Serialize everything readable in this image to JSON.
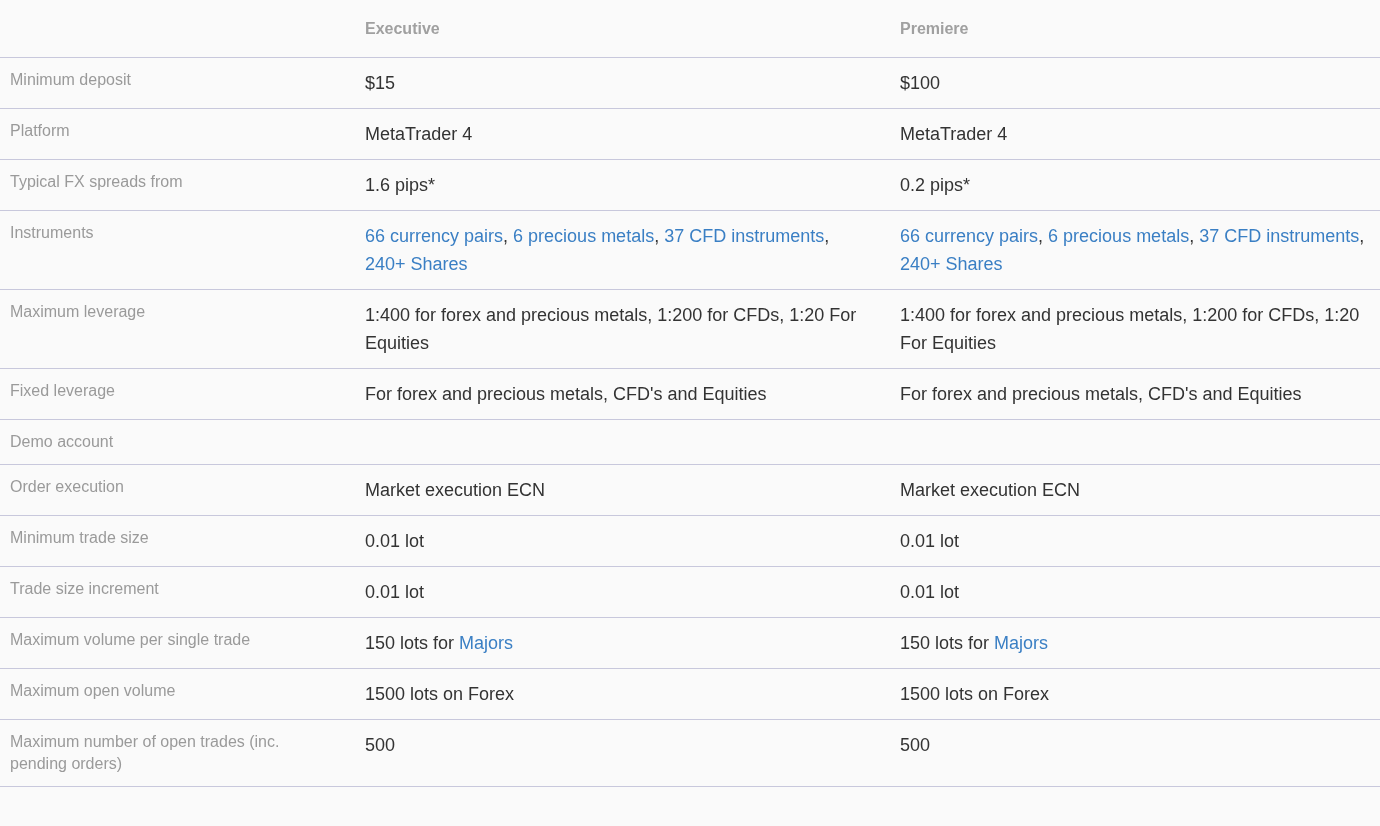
{
  "table": {
    "columns": [
      "Executive",
      "Premiere"
    ],
    "rows": [
      {
        "label": "Minimum deposit",
        "values": [
          [
            {
              "kind": "text",
              "text": "$15"
            }
          ],
          [
            {
              "kind": "text",
              "text": "$100"
            }
          ]
        ]
      },
      {
        "label": "Platform",
        "values": [
          [
            {
              "kind": "text",
              "text": "MetaTrader 4"
            }
          ],
          [
            {
              "kind": "text",
              "text": "MetaTrader 4"
            }
          ]
        ]
      },
      {
        "label": "Typical FX spreads from",
        "values": [
          [
            {
              "kind": "text",
              "text": "1.6 pips*"
            }
          ],
          [
            {
              "kind": "text",
              "text": "0.2 pips*"
            }
          ]
        ]
      },
      {
        "label": "Instruments",
        "values": [
          [
            {
              "kind": "link",
              "text": "66 currency pairs"
            },
            {
              "kind": "text",
              "text": ", "
            },
            {
              "kind": "link",
              "text": "6 precious metals"
            },
            {
              "kind": "text",
              "text": ", "
            },
            {
              "kind": "link",
              "text": "37 CFD instruments"
            },
            {
              "kind": "text",
              "text": ", "
            },
            {
              "kind": "link",
              "text": "240+ Shares"
            }
          ],
          [
            {
              "kind": "link",
              "text": "66 currency pairs"
            },
            {
              "kind": "text",
              "text": ", "
            },
            {
              "kind": "link",
              "text": "6 precious metals"
            },
            {
              "kind": "text",
              "text": ", "
            },
            {
              "kind": "link",
              "text": "37 CFD instruments"
            },
            {
              "kind": "text",
              "text": ", "
            },
            {
              "kind": "link",
              "text": "240+ Shares"
            }
          ]
        ]
      },
      {
        "label": "Maximum leverage",
        "values": [
          [
            {
              "kind": "text",
              "text": "1:400 for forex and precious metals, 1:200 for CFDs, 1:20 For Equities"
            }
          ],
          [
            {
              "kind": "text",
              "text": "1:400 for forex and precious metals, 1:200 for CFDs, 1:20 For Equities"
            }
          ]
        ]
      },
      {
        "label": "Fixed leverage",
        "values": [
          [
            {
              "kind": "text",
              "text": "For forex and precious metals, CFD's and Equities"
            }
          ],
          [
            {
              "kind": "text",
              "text": "For forex and precious metals, CFD's and Equities"
            }
          ]
        ]
      },
      {
        "label": "Demo account"
      },
      {
        "label": "Order execution",
        "values": [
          [
            {
              "kind": "text",
              "text": "Market execution ECN"
            }
          ],
          [
            {
              "kind": "text",
              "text": "Market execution ECN"
            }
          ]
        ]
      },
      {
        "label": "Minimum trade size",
        "values": [
          [
            {
              "kind": "text",
              "text": "0.01 lot"
            }
          ],
          [
            {
              "kind": "text",
              "text": "0.01 lot"
            }
          ]
        ]
      },
      {
        "label": "Trade size increment",
        "values": [
          [
            {
              "kind": "text",
              "text": "0.01 lot"
            }
          ],
          [
            {
              "kind": "text",
              "text": "0.01 lot"
            }
          ]
        ]
      },
      {
        "label": "Maximum volume per single trade",
        "values": [
          [
            {
              "kind": "text",
              "text": "150 lots for "
            },
            {
              "kind": "link",
              "text": "Majors"
            }
          ],
          [
            {
              "kind": "text",
              "text": "150 lots for "
            },
            {
              "kind": "link",
              "text": "Majors"
            }
          ]
        ]
      },
      {
        "label": "Maximum open volume",
        "values": [
          [
            {
              "kind": "text",
              "text": "1500 lots on Forex"
            }
          ],
          [
            {
              "kind": "text",
              "text": "1500 lots on Forex"
            }
          ]
        ]
      },
      {
        "label": "Maximum number of open trades (inc. pending orders)",
        "values": [
          [
            {
              "kind": "text",
              "text": "500"
            }
          ],
          [
            {
              "kind": "text",
              "text": "500"
            }
          ]
        ]
      }
    ]
  }
}
